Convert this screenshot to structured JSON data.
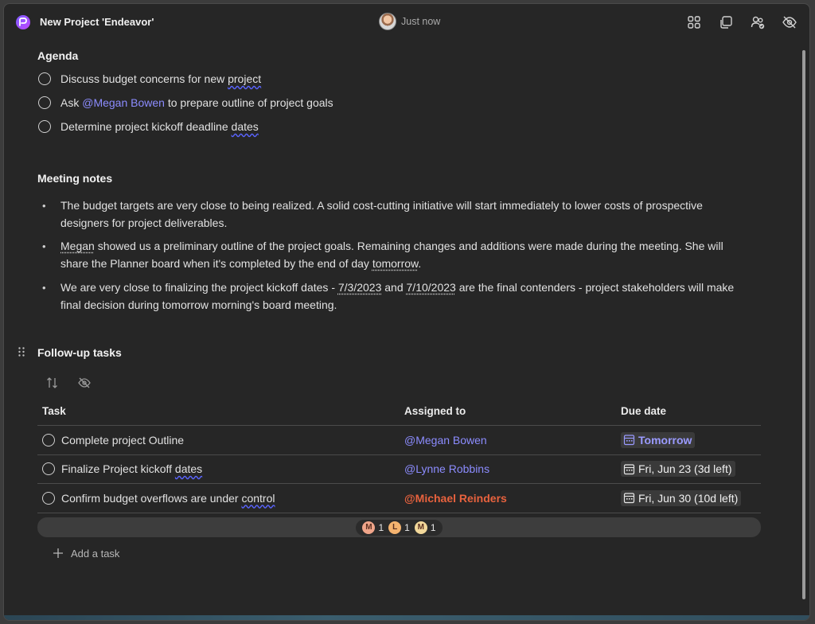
{
  "header": {
    "title": "New Project 'Endeavor'",
    "presence_text": "Just now",
    "actions": [
      {
        "icon": "apps-grid-icon"
      },
      {
        "icon": "copy-component-icon"
      },
      {
        "icon": "people-settings-icon"
      },
      {
        "icon": "eye-off-icon"
      }
    ]
  },
  "agenda": {
    "title": "Agenda",
    "items": [
      {
        "before": "Discuss budget concerns for new ",
        "underlined": "project"
      },
      {
        "before": "Ask ",
        "mention": "@Megan Bowen",
        "after": " to prepare outline of project goals"
      },
      {
        "before": "Determine project kickoff deadline ",
        "underlined": "dates"
      }
    ]
  },
  "notes": {
    "title": "Meeting notes",
    "bullets": [
      {
        "text": "The budget targets are very close to being realized. A solid cost-cutting initiative will start immediately to lower costs of prospective designers for project deliverables."
      },
      {
        "p1": "Megan",
        "p2": " showed us a preliminary outline of the project goals. Remaining changes and additions were made during the meeting. She will share the Planner board when it's completed by the end of day ",
        "p3": "tomorrow",
        "p4": "."
      },
      {
        "p1": "We are very close to finalizing the project kickoff dates - ",
        "d1": "7/3/2023",
        "p2": " and ",
        "d2": "7/10/2023",
        "p3": " are the final contenders - project stakeholders will make final decision during tomorrow morning's board meeting."
      }
    ]
  },
  "tasks": {
    "title": "Follow-up tasks",
    "columns": {
      "task": "Task",
      "assigned": "Assigned to",
      "due": "Due date"
    },
    "rows": [
      {
        "task": "Complete project Outline",
        "task_underlined": "",
        "assigned": "@Megan Bowen",
        "due": "Tomorrow"
      },
      {
        "task": "Finalize Project kickoff ",
        "task_underlined": "dates",
        "assigned": "@Lynne Robbins",
        "due": "Fri, Jun 23 (3d left)"
      },
      {
        "task": "Confirm budget overflows are under ",
        "task_underlined": "control",
        "assigned": "@Michael Reinders",
        "due": "Fri, Jun 30 (10d left)"
      }
    ],
    "summary": [
      {
        "initial": "M",
        "count": "1",
        "color": "#f0a58a"
      },
      {
        "initial": "L",
        "count": "1",
        "color": "#f4b36f"
      },
      {
        "initial": "M",
        "count": "1",
        "color": "#f2d89a"
      }
    ],
    "add_task_label": "Add a task"
  },
  "colors": {
    "background": "#262626",
    "mention": "#8c8cff",
    "urgent": "#e8623e",
    "spell_underline": "#5a64ff"
  }
}
